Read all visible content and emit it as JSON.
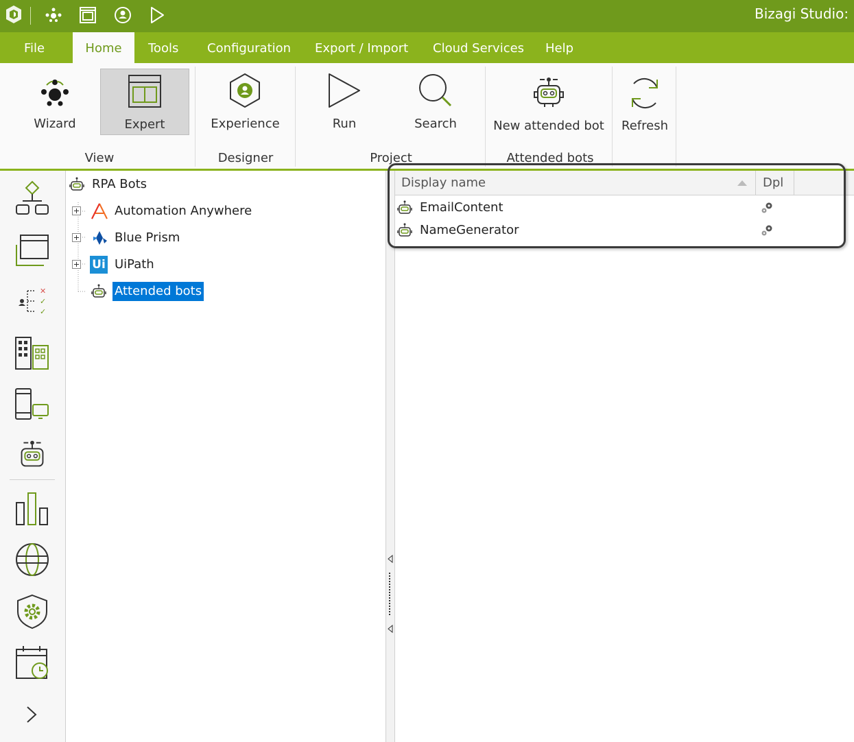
{
  "window": {
    "title": "Bizagi Studio: R"
  },
  "menu": {
    "items": [
      "File",
      "Home",
      "Tools",
      "Configuration",
      "Export / Import",
      "Cloud Services",
      "Help"
    ],
    "active": "Home"
  },
  "ribbon": {
    "buttons": {
      "wizard": "Wizard",
      "expert": "Expert",
      "experience": "Experience",
      "run": "Run",
      "search": "Search",
      "new_attended_bot": "New attended bot",
      "refresh": "Refresh"
    },
    "groups": {
      "view": "View",
      "designer": "Designer",
      "project": "Project",
      "attended_bots": "Attended bots"
    }
  },
  "tree": {
    "root": "RPA Bots",
    "children": [
      {
        "label": "Automation Anywhere",
        "icon": "automation-anywhere-icon"
      },
      {
        "label": "Blue Prism",
        "icon": "blue-prism-icon"
      },
      {
        "label": "UiPath",
        "icon": "uipath-icon",
        "badge": "Ui"
      },
      {
        "label": "Attended bots",
        "icon": "robot-icon",
        "selected": true
      }
    ]
  },
  "grid": {
    "columns": [
      "Display name",
      "Dpl"
    ],
    "rows": [
      {
        "name": "EmailContent",
        "icon": "robot-icon",
        "action_icon": "gears-icon"
      },
      {
        "name": "NameGenerator",
        "icon": "robot-icon",
        "action_icon": "gears-icon"
      }
    ]
  },
  "colors": {
    "title_green": "#6f9a1c",
    "menu_green": "#8bb31d",
    "selection_blue": "#0078d7",
    "uipath_blue": "#1b8fd6"
  }
}
